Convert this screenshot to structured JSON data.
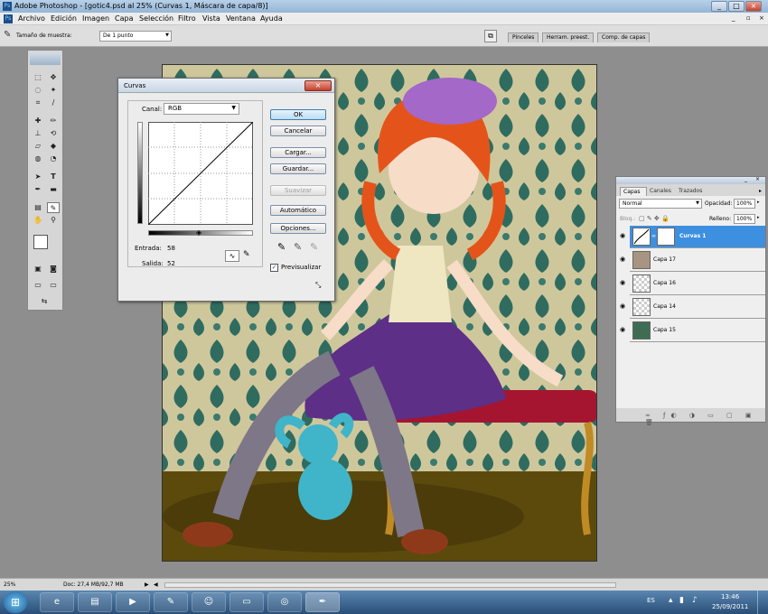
{
  "window": {
    "title": "Adobe Photoshop - [gotic4.psd al 25% (Curvas 1, Máscara de capa/8)]"
  },
  "menu": [
    "Archivo",
    "Edición",
    "Imagen",
    "Capa",
    "Selección",
    "Filtro",
    "Vista",
    "Ventana",
    "Ayuda"
  ],
  "options": {
    "sample_label": "Tamaño de muestra:",
    "sample_value": "De 1 punto"
  },
  "well_tabs": [
    "Pinceles",
    "Herram. preest.",
    "Comp. de capas"
  ],
  "curves": {
    "title": "Curvas",
    "channel_label": "Canal:",
    "channel_value": "RGB",
    "input_label": "Entrada:",
    "input_value": "58",
    "output_label": "Salida:",
    "output_value": "52",
    "buttons": {
      "ok": "OK",
      "cancel": "Cancelar",
      "load": "Cargar...",
      "save": "Guardar...",
      "smooth": "Suavizar",
      "auto": "Automático",
      "options": "Opciones..."
    },
    "preview_label": "Previsualizar",
    "preview_checked": true
  },
  "layers": {
    "tabs": [
      "Capas",
      "Canales",
      "Trazados"
    ],
    "blend_mode": "Normal",
    "opacity_label": "Opacidad:",
    "opacity_value": "100%",
    "lock_label": "Bloq.:",
    "fill_label": "Relleno:",
    "fill_value": "100%",
    "items": [
      {
        "name": "Curvas 1",
        "selected": true
      },
      {
        "name": "Capa 17",
        "selected": false
      },
      {
        "name": "Capa 16",
        "selected": false
      },
      {
        "name": "Capa 14",
        "selected": false
      },
      {
        "name": "Capa 15",
        "selected": false
      }
    ]
  },
  "status": {
    "zoom": "25%",
    "doc": "Doc: 27,4 MB/92,7 MB"
  },
  "taskbar": {
    "lang": "ES",
    "time": "13:46",
    "date": "25/09/2011"
  },
  "colors": {
    "accent": "#3399ff",
    "titlebar": "#a9c4e1",
    "workspace": "#8e8e8e",
    "selected_layer": "#3d8fe0"
  }
}
